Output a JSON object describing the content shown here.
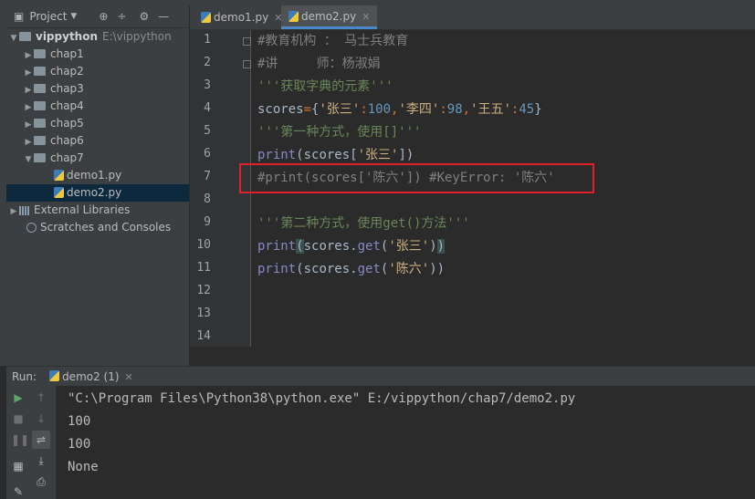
{
  "project_panel": {
    "title": "Project",
    "tree": [
      {
        "label": "vippython",
        "hint": "E:\\vippython",
        "type": "root",
        "expanded": true
      },
      {
        "label": "chap1",
        "type": "folder",
        "expanded": false
      },
      {
        "label": "chap2",
        "type": "folder",
        "expanded": false
      },
      {
        "label": "chap3",
        "type": "folder",
        "expanded": false
      },
      {
        "label": "chap4",
        "type": "folder",
        "expanded": false
      },
      {
        "label": "chap5",
        "type": "folder",
        "expanded": false
      },
      {
        "label": "chap6",
        "type": "folder",
        "expanded": false
      },
      {
        "label": "chap7",
        "type": "folder",
        "expanded": true
      },
      {
        "label": "demo1.py",
        "type": "file"
      },
      {
        "label": "demo2.py",
        "type": "file",
        "selected": true
      },
      {
        "label": "External Libraries",
        "type": "libraries"
      },
      {
        "label": "Scratches and Consoles",
        "type": "scratches"
      }
    ]
  },
  "editor": {
    "tabs": [
      {
        "label": "demo1.py",
        "active": false
      },
      {
        "label": "demo2.py",
        "active": true
      }
    ],
    "line_numbers": [
      "1",
      "2",
      "3",
      "4",
      "5",
      "6",
      "7",
      "8",
      "9",
      "10",
      "11",
      "12",
      "13",
      "14"
    ],
    "lines": {
      "l1": "#教育机构 ： 马士兵教育",
      "l2": "#讲     师：杨淑娟",
      "l3": "'''获取字典的元素'''",
      "l4_a": "scores",
      "l4_b": "=",
      "l4_c": "{",
      "l4_d": "'张三'",
      "l4_e": ":",
      "l4_f": "100",
      "l4_g": ",",
      "l4_h": "'李四'",
      "l4_i": ":",
      "l4_j": "98",
      "l4_k": ",",
      "l4_l": "'王五'",
      "l4_m": ":",
      "l4_n": "45",
      "l4_o": "}",
      "l5": "'''第一种方式，使用[]'''",
      "l6_a": "print",
      "l6_b": "(scores[",
      "l6_c": "'张三'",
      "l6_d": "])",
      "l7": "#print(scores['陈六']) #KeyError: '陈六'",
      "l9": "'''第二种方式，使用get()方法'''",
      "l10_a": "print",
      "l10_b": "(",
      "l10_c": "scores.",
      "l10_d": "get",
      "l10_e": "(",
      "l10_f": "'张三'",
      "l10_g": ")",
      "l10_h": ")",
      "l11_a": "print",
      "l11_b": "(scores.",
      "l11_c": "get",
      "l11_d": "(",
      "l11_e": "'陈六'",
      "l11_f": "))"
    }
  },
  "run_panel": {
    "label": "Run:",
    "tab_label": "demo2 (1)",
    "console": [
      "\"C:\\Program Files\\Python38\\python.exe\" E:/vippython/chap7/demo2.py",
      "100",
      "100",
      "None"
    ]
  },
  "colors": {
    "highlight_box": "#e0202a",
    "selection": "#0d293e"
  }
}
